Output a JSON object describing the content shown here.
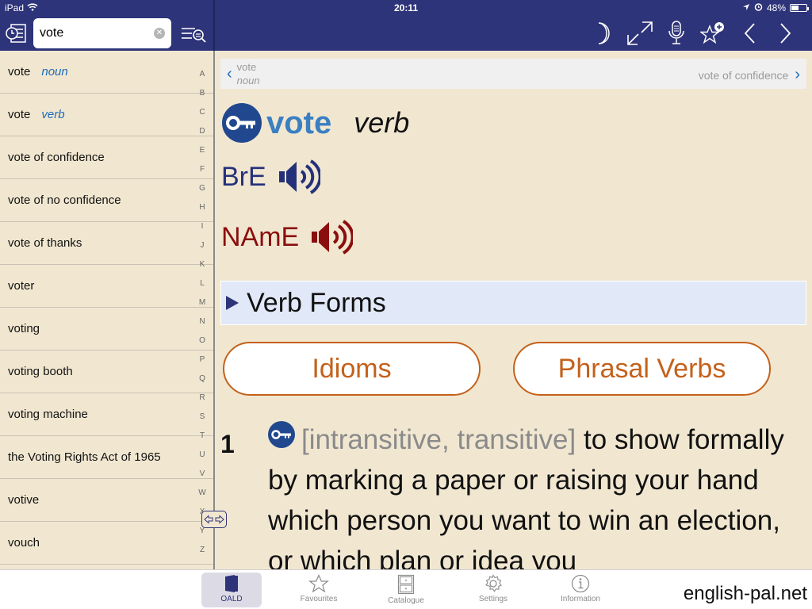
{
  "status_bar": {
    "device": "iPad",
    "time": "20:11",
    "battery": "48%",
    "battery_level": 0.48
  },
  "search": {
    "value": "vote",
    "placeholder": ""
  },
  "toolbar": {
    "icons": [
      "history-icon",
      "search-options-icon",
      "night-mode-icon",
      "fullscreen-icon",
      "microphone-icon",
      "add-favourite-icon",
      "back-icon",
      "forward-icon"
    ]
  },
  "word_list": [
    {
      "word": "vote",
      "pos": "noun"
    },
    {
      "word": "vote",
      "pos": "verb"
    },
    {
      "word": "vote of confidence",
      "pos": ""
    },
    {
      "word": "vote of no confidence",
      "pos": ""
    },
    {
      "word": "vote of thanks",
      "pos": ""
    },
    {
      "word": "voter",
      "pos": ""
    },
    {
      "word": "voting",
      "pos": ""
    },
    {
      "word": "voting booth",
      "pos": ""
    },
    {
      "word": "voting machine",
      "pos": ""
    },
    {
      "word": "the Voting Rights Act of 1965",
      "pos": ""
    },
    {
      "word": "votive",
      "pos": ""
    },
    {
      "word": "vouch",
      "pos": ""
    }
  ],
  "alphabet": [
    "A",
    "B",
    "C",
    "D",
    "E",
    "F",
    "G",
    "H",
    "I",
    "J",
    "K",
    "L",
    "M",
    "N",
    "O",
    "P",
    "Q",
    "R",
    "S",
    "T",
    "U",
    "V",
    "W",
    "X",
    "Y",
    "Z"
  ],
  "entry_nav": {
    "prev_word": "vote",
    "prev_pos": "noun",
    "next_word": "vote of confidence"
  },
  "entry": {
    "headword": "vote",
    "pos": "verb",
    "pron_bre": "BrE",
    "pron_name": "NAmE",
    "verb_forms_label": "Verb Forms",
    "idioms_label": "Idioms",
    "phrasal_verbs_label": "Phrasal Verbs",
    "sense_number": "1",
    "sense_grammar": "[intransitive, transitive]",
    "sense_definition": "to show formally by marking a paper or raising your hand which person you want to win an election, or which plan or idea you"
  },
  "colors": {
    "header_bg": "#2e3479",
    "headword": "#3b7fc2",
    "bre": "#24317a",
    "name": "#8b0e0e",
    "accent_orange": "#c4611b",
    "page_bg": "#f1e7d1"
  },
  "bottom_tabs": [
    {
      "label": "OALD",
      "icon": "book-icon",
      "active": true
    },
    {
      "label": "Favourites",
      "icon": "star-icon",
      "active": false
    },
    {
      "label": "Catalogue",
      "icon": "cabinet-icon",
      "active": false
    },
    {
      "label": "Settings",
      "icon": "gear-icon",
      "active": false
    },
    {
      "label": "Information",
      "icon": "info-icon",
      "active": false
    }
  ],
  "watermark": "english-pal.net"
}
